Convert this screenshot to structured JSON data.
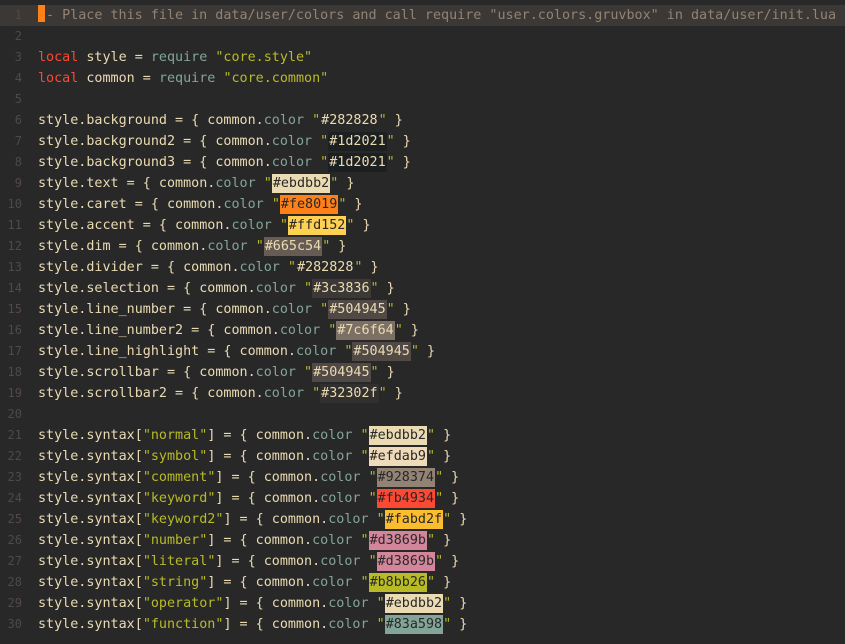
{
  "editor": {
    "lines": [
      {
        "n": "1",
        "tokens": [
          {
            "cls": "cmt",
            "t": "- Place this file in data/user/colors and call require \"user.colors.gruvbox\" in data/user/init.lua"
          }
        ]
      },
      {
        "n": "2",
        "tokens": []
      },
      {
        "n": "3",
        "tokens": [
          {
            "cls": "kw",
            "t": "local"
          },
          {
            "cls": "nrm",
            "t": " style = "
          },
          {
            "cls": "mem",
            "t": "require"
          },
          {
            "cls": "nrm",
            "t": " "
          },
          {
            "cls": "str",
            "t": "\"core.style\""
          }
        ]
      },
      {
        "n": "4",
        "tokens": [
          {
            "cls": "kw",
            "t": "local"
          },
          {
            "cls": "nrm",
            "t": " common = "
          },
          {
            "cls": "mem",
            "t": "require"
          },
          {
            "cls": "nrm",
            "t": " "
          },
          {
            "cls": "str",
            "t": "\"core.common\""
          }
        ]
      },
      {
        "n": "5",
        "tokens": []
      },
      {
        "n": "6",
        "prefix": "style.background = { common.",
        "hex": "#282828",
        "swatch": "#282828",
        "dark": true
      },
      {
        "n": "7",
        "prefix": "style.background2 = { common.",
        "hex": "#1d2021",
        "swatch": "#1d2021",
        "dark": true
      },
      {
        "n": "8",
        "prefix": "style.background3 = { common.",
        "hex": "#1d2021",
        "swatch": "#1d2021",
        "dark": true
      },
      {
        "n": "9",
        "prefix": "style.text = { common.",
        "hex": "#ebdbb2",
        "swatch": "#ebdbb2",
        "dark": false
      },
      {
        "n": "10",
        "prefix": "style.caret = { common.",
        "hex": "#fe8019",
        "swatch": "#fe8019",
        "dark": false
      },
      {
        "n": "11",
        "prefix": "style.accent = { common.",
        "hex": "#ffd152",
        "swatch": "#ffd152",
        "dark": false
      },
      {
        "n": "12",
        "prefix": "style.dim = { common.",
        "hex": "#665c54",
        "swatch": "#665c54",
        "dark": true
      },
      {
        "n": "13",
        "prefix": "style.divider = { common.",
        "hex": "#282828",
        "swatch": "#282828",
        "dark": true
      },
      {
        "n": "14",
        "prefix": "style.selection = { common.",
        "hex": "#3c3836",
        "swatch": "#3c3836",
        "dark": true
      },
      {
        "n": "15",
        "prefix": "style.line_number = { common.",
        "hex": "#504945",
        "swatch": "#504945",
        "dark": true
      },
      {
        "n": "16",
        "prefix": "style.line_number2 = { common.",
        "hex": "#7c6f64",
        "swatch": "#7c6f64",
        "dark": true
      },
      {
        "n": "17",
        "prefix": "style.line_highlight = { common.",
        "hex": "#504945",
        "swatch": "#504945",
        "dark": true
      },
      {
        "n": "18",
        "prefix": "style.scrollbar = { common.",
        "hex": "#504945",
        "swatch": "#504945",
        "dark": true
      },
      {
        "n": "19",
        "prefix": "style.scrollbar2 = { common.",
        "hex": "#32302f",
        "swatch": "#32302f",
        "dark": true
      },
      {
        "n": "20",
        "tokens": []
      },
      {
        "n": "21",
        "syntax": "normal",
        "hex": "#ebdbb2",
        "swatch": "#ebdbb2",
        "dark": false
      },
      {
        "n": "22",
        "syntax": "symbol",
        "hex": "#efdab9",
        "swatch": "#efdab9",
        "dark": false
      },
      {
        "n": "23",
        "syntax": "comment",
        "hex": "#928374",
        "swatch": "#928374",
        "dark": false
      },
      {
        "n": "24",
        "syntax": "keyword",
        "hex": "#fb4934",
        "swatch": "#fb4934",
        "dark": false
      },
      {
        "n": "25",
        "syntax": "keyword2",
        "hex": "#fabd2f",
        "swatch": "#fabd2f",
        "dark": false
      },
      {
        "n": "26",
        "syntax": "number",
        "hex": "#d3869b",
        "swatch": "#d3869b",
        "dark": false
      },
      {
        "n": "27",
        "syntax": "literal",
        "hex": "#d3869b",
        "swatch": "#d3869b",
        "dark": false
      },
      {
        "n": "28",
        "syntax": "string",
        "hex": "#b8bb26",
        "swatch": "#b8bb26",
        "dark": false
      },
      {
        "n": "29",
        "syntax": "operator",
        "hex": "#ebdbb2",
        "swatch": "#ebdbb2",
        "dark": false
      },
      {
        "n": "30",
        "syntax": "function",
        "hex": "#83a598",
        "swatch": "#83a598",
        "dark": false
      }
    ],
    "highlight_line": "1",
    "color_method": "color",
    "syntax_prefix": "style.syntax[",
    "syntax_mid": "] = { common.",
    "close": " }",
    "colors": {
      "background": "#282828",
      "keyword": "#fb4934",
      "string": "#b8bb26",
      "member": "#83a598",
      "comment": "#928374",
      "line_number": "#504945",
      "caret": "#fe8019"
    }
  }
}
